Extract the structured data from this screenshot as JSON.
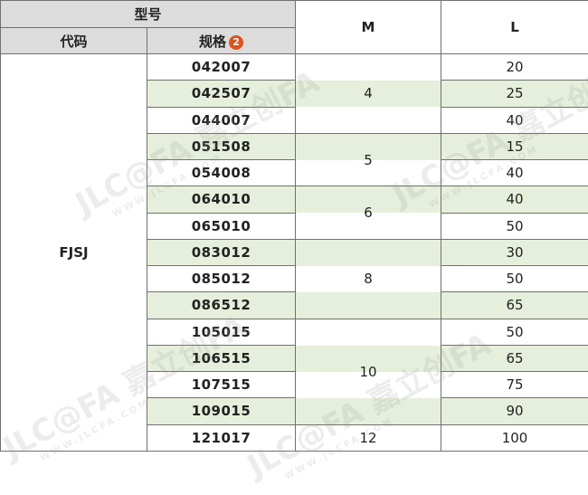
{
  "header": {
    "model_label": "型号",
    "code_label": "代码",
    "spec_label": "规格",
    "spec_badge": "2",
    "m_label": "M",
    "l_label": "L"
  },
  "model_code": "FJSJ",
  "rows": [
    {
      "spec": "042007",
      "l": "20"
    },
    {
      "spec": "042507",
      "l": "25"
    },
    {
      "spec": "044007",
      "l": "40"
    },
    {
      "spec": "051508",
      "l": "15"
    },
    {
      "spec": "054008",
      "l": "40"
    },
    {
      "spec": "064010",
      "l": "40"
    },
    {
      "spec": "065010",
      "l": "50"
    },
    {
      "spec": "083012",
      "l": "30"
    },
    {
      "spec": "085012",
      "l": "50"
    },
    {
      "spec": "086512",
      "l": "65"
    },
    {
      "spec": "105015",
      "l": "50"
    },
    {
      "spec": "106515",
      "l": "65"
    },
    {
      "spec": "107515",
      "l": "75"
    },
    {
      "spec": "109015",
      "l": "90"
    },
    {
      "spec": "121017",
      "l": "100"
    }
  ],
  "m_groups": [
    {
      "value": "4"
    },
    {
      "value": "5"
    },
    {
      "value": "6"
    },
    {
      "value": "8"
    },
    {
      "value": "10"
    },
    {
      "value": "12"
    }
  ],
  "watermark": {
    "brand": "JLC@FA 嘉立创FA",
    "url": "WWW.JLCFA.COM"
  },
  "colors": {
    "row_stripe": "#e6efdb",
    "header_bg": "#dcdcdc",
    "code_text": "#3c739c",
    "badge": "#e0521c"
  }
}
